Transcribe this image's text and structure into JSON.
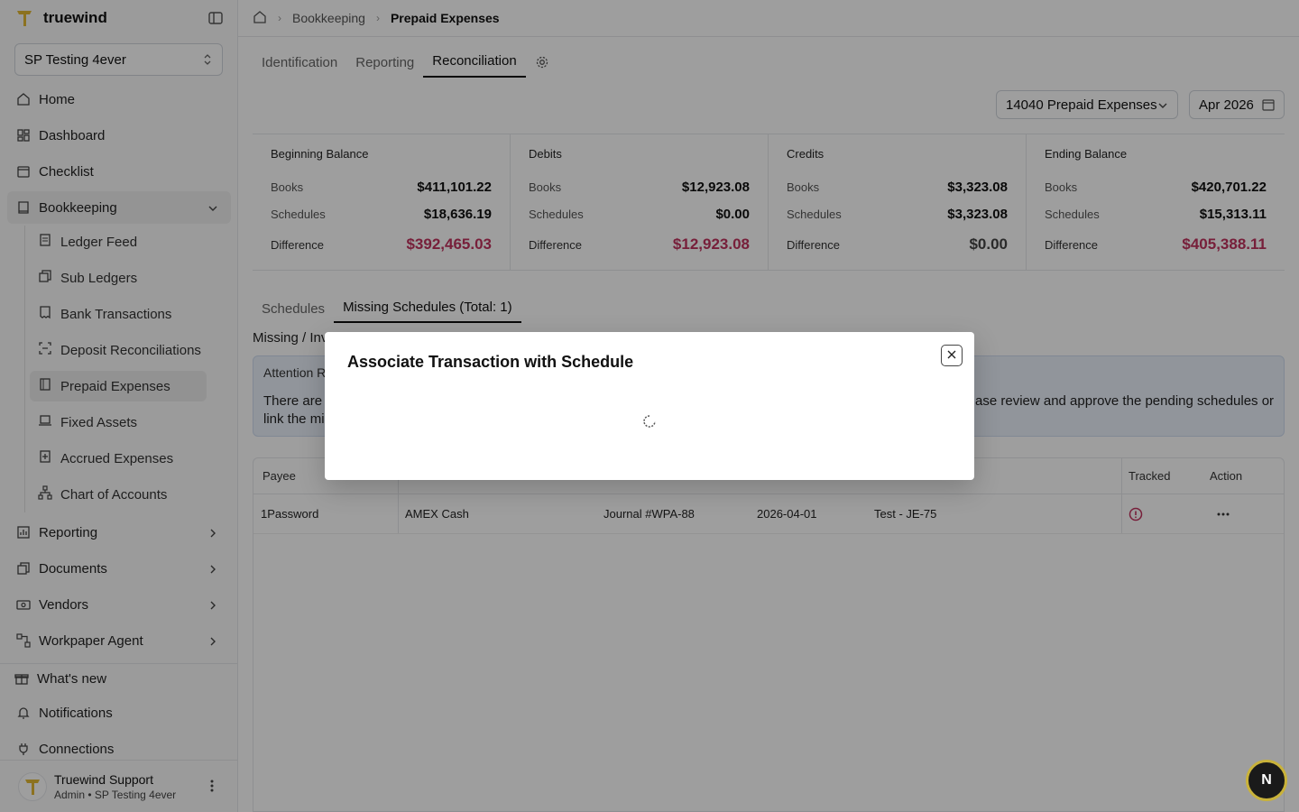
{
  "app": {
    "name": "truewind"
  },
  "org_selector": {
    "value": "SP Testing 4ever"
  },
  "sidebar": {
    "items": [
      {
        "label": "Home",
        "icon": "home-icon"
      },
      {
        "label": "Dashboard",
        "icon": "dashboard-icon"
      },
      {
        "label": "Checklist",
        "icon": "calendar-icon"
      },
      {
        "label": "Bookkeeping",
        "icon": "book-icon"
      }
    ],
    "bookkeeping_sub": [
      {
        "label": "Ledger Feed",
        "icon": "ledger-icon"
      },
      {
        "label": "Sub Ledgers",
        "icon": "copy-icon"
      },
      {
        "label": "Bank Transactions",
        "icon": "receipt-icon"
      },
      {
        "label": "Deposit Reconciliations",
        "icon": "scan-icon"
      },
      {
        "label": "Prepaid Expenses",
        "icon": "notebook-icon"
      },
      {
        "label": "Fixed Assets",
        "icon": "laptop-icon"
      },
      {
        "label": "Accrued Expenses",
        "icon": "plus-doc-icon"
      },
      {
        "label": "Chart of Accounts",
        "icon": "network-icon"
      }
    ],
    "groups": [
      {
        "label": "Reporting",
        "icon": "chart-icon"
      },
      {
        "label": "Documents",
        "icon": "documents-icon"
      },
      {
        "label": "Vendors",
        "icon": "vendor-icon"
      },
      {
        "label": "Workpaper Agent",
        "icon": "workflow-icon"
      }
    ],
    "bottom": [
      {
        "label": "What's new",
        "icon": "gift-icon"
      },
      {
        "label": "Notifications",
        "icon": "bell-icon"
      },
      {
        "label": "Connections",
        "icon": "plug-icon"
      }
    ],
    "user": {
      "name": "Truewind Support",
      "role": "Admin • SP Testing 4ever"
    }
  },
  "breadcrumb": {
    "parent": "Bookkeeping",
    "current": "Prepaid Expenses"
  },
  "tabs": [
    "Identification",
    "Reporting",
    "Reconciliation"
  ],
  "filters": {
    "account": "14040 Prepaid Expenses",
    "period": "Apr 2026"
  },
  "summary": [
    {
      "title": "Beginning Balance",
      "books": "$411,101.22",
      "schedules": "$18,636.19",
      "difference": "$392,465.03",
      "diff_color": "#c0325e"
    },
    {
      "title": "Debits",
      "books": "$12,923.08",
      "schedules": "$0.00",
      "difference": "$12,923.08",
      "diff_color": "#c0325e"
    },
    {
      "title": "Credits",
      "books": "$3,323.08",
      "schedules": "$3,323.08",
      "difference": "$0.00",
      "diff_color": "#444444"
    },
    {
      "title": "Ending Balance",
      "books": "$420,701.22",
      "schedules": "$15,313.11",
      "difference": "$405,388.11",
      "diff_color": "#c0325e"
    }
  ],
  "labels": {
    "books": "Books",
    "schedules": "Schedules",
    "difference": "Difference"
  },
  "subtabs": [
    "Schedules",
    "Missing Schedules (Total: 1)"
  ],
  "section": {
    "title": "Missing / Inv"
  },
  "attention": {
    "title": "Attention R",
    "body_left": "There are",
    "body_left2": "link the mi",
    "body_right": "ase review and approve the pending schedules or"
  },
  "table": {
    "headers": {
      "payee": "Payee",
      "tracked": "Tracked",
      "action": "Action"
    },
    "rows": [
      {
        "payee": "1Password",
        "account": "AMEX Cash",
        "journal": "Journal #WPA-88",
        "date": "2026-04-01",
        "memo": "Test - JE-75"
      }
    ]
  },
  "modal": {
    "title": "Associate Transaction with Schedule"
  },
  "badge": {
    "letter": "N"
  }
}
